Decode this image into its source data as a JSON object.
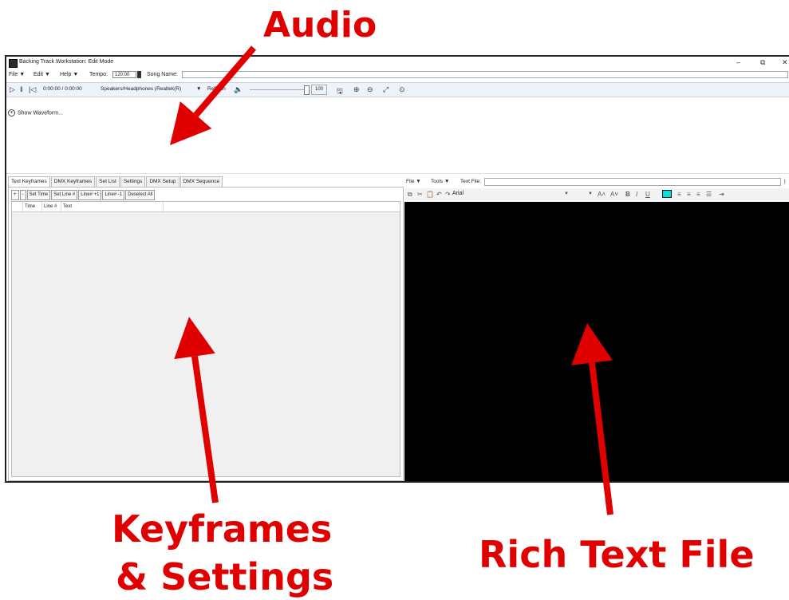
{
  "annotations": {
    "audio": "Audio",
    "keyframes_line1": "Keyframes",
    "keyframes_line2": "& Settings",
    "rich_text": "Rich Text File",
    "color": "#e00000"
  },
  "window": {
    "title": "Backing Track Workstation: Edit Mode",
    "controls": {
      "minimize": "–",
      "maximize": "⧉",
      "close": "✕"
    }
  },
  "menubar": {
    "file": "File ▼",
    "edit": "Edit ▼",
    "help": "Help ▼",
    "tempo_label": "Tempo:",
    "tempo_value": "120.00",
    "song_name_label": "Song Name:",
    "song_name_value": ""
  },
  "transport": {
    "play_icon": "▷",
    "pause_icon": "‖",
    "rewind_icon": "|◁",
    "time": "0:00:00 / 0:00:00",
    "device": "Speakers/Headphones (Realtek(R)",
    "refresh": "Refresh",
    "volume_value": "100",
    "volume_level": 1.0
  },
  "waveform": {
    "toggle_label": "Show Waveform..."
  },
  "left_tabs": [
    "Text Keyframes",
    "DMX Keyframes",
    "Set List",
    "Settings",
    "DMX Setup",
    "DMX Sequence"
  ],
  "keyframe_buttons": [
    "+",
    "-",
    "Set Time",
    "Set Line #",
    "Line# +1",
    "Line# -1",
    "Deselect All"
  ],
  "grid_columns": [
    "Time",
    "Line #",
    "Text"
  ],
  "rich_text": {
    "file_menu": "File ▼",
    "tools_menu": "Tools ▼",
    "text_file_label": "Text File:",
    "text_file_value": "",
    "font_name": "Arial",
    "bold": "B",
    "italic": "I",
    "underline": "U",
    "highlight_color": "#00e0e0",
    "editor_background": "#000000"
  }
}
